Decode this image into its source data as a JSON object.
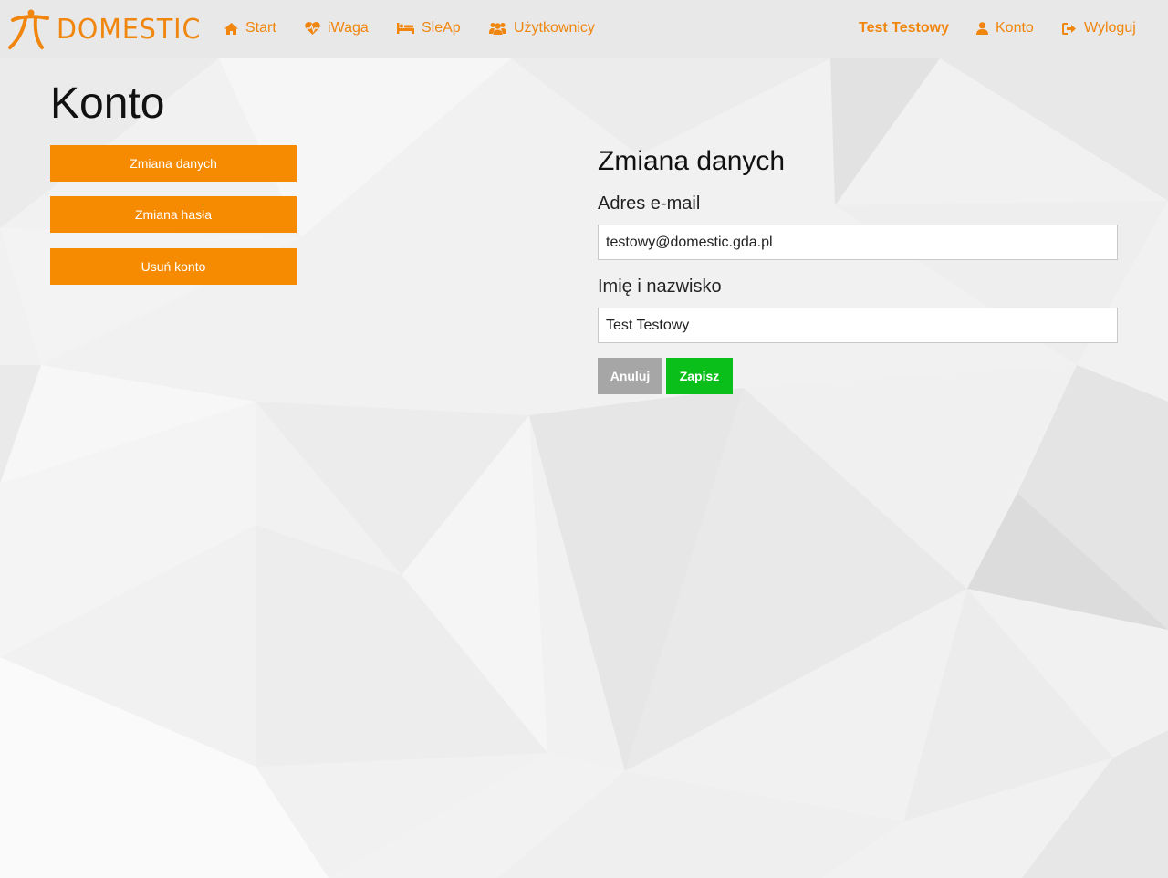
{
  "brand": {
    "name": "DOMESTIC",
    "icon": "domestic-logo-icon"
  },
  "nav": {
    "items": [
      {
        "label": "Start",
        "icon": "home-icon"
      },
      {
        "label": "iWaga",
        "icon": "heartbeat-icon"
      },
      {
        "label": "SleAp",
        "icon": "bed-icon"
      },
      {
        "label": "Użytkownicy",
        "icon": "users-icon"
      }
    ],
    "user_name": "Test Testowy",
    "account": {
      "label": "Konto",
      "icon": "user-icon"
    },
    "logout": {
      "label": "Wyloguj",
      "icon": "sign-out-icon"
    }
  },
  "page": {
    "title": "Konto"
  },
  "sidebar": {
    "buttons": [
      {
        "label": "Zmiana danych"
      },
      {
        "label": "Zmiana hasła"
      },
      {
        "label": "Usuń konto"
      }
    ]
  },
  "form": {
    "title": "Zmiana danych",
    "email_label": "Adres e-mail",
    "email_value": "testowy@domestic.gda.pl",
    "name_label": "Imię i nazwisko",
    "name_value": "Test Testowy",
    "cancel_label": "Anuluj",
    "save_label": "Zapisz"
  },
  "colors": {
    "accent": "#f0860e",
    "sidebar_button": "#f68a00",
    "save_button": "#0bbf1b",
    "cancel_button": "#a6a6a6",
    "navbar": "#e8e8e8"
  }
}
